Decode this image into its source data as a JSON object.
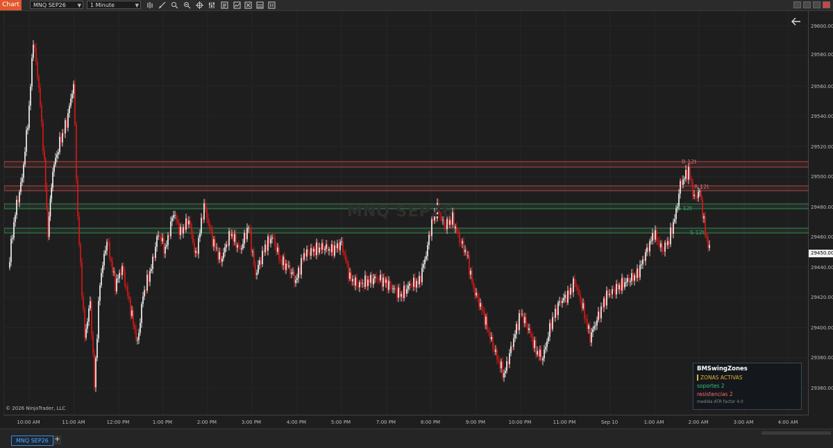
{
  "toolbar": {
    "chart_tab": "Chart",
    "instrument": "MNQ SEP26",
    "interval": "1 Minute",
    "icons": [
      "bars-icon",
      "draw-icon",
      "zoom-icon",
      "crosshair-icon",
      "data-box-icon",
      "indicators-icon",
      "strategies-icon",
      "properties-icon",
      "templates-icon",
      "chart-trader-icon"
    ]
  },
  "chart": {
    "watermark": "MNQ SEP26",
    "copyright": "© 2026 NinjaTrader, LLC",
    "current_price": "29450.00",
    "zone_labels": {
      "r1": "R 12t",
      "r2": "R 12t",
      "s1": "S 12t",
      "s2": "S 12t"
    },
    "colors": {
      "up": "#ffffff",
      "down": "#e01818",
      "resistance": "#d05050",
      "support": "#3fa060"
    }
  },
  "price_axis": [
    "29600.00",
    "29580.00",
    "29560.00",
    "29540.00",
    "29520.00",
    "29500.00",
    "29480.00",
    "29460.00",
    "29440.00",
    "29420.00",
    "29400.00",
    "29380.00",
    "29360.00"
  ],
  "time_axis": [
    "10:00 AM",
    "11:00 AM",
    "12:00 PM",
    "1:00 PM",
    "2:00 PM",
    "3:00 PM",
    "4:00 PM",
    "5:00 PM",
    "7:00 PM",
    "8:00 PM",
    "9:00 PM",
    "10:00 PM",
    "11:00 PM",
    "Sep 10",
    "1:00 AM",
    "2:00 AM",
    "3:00 AM",
    "4:00 AM"
  ],
  "legend": {
    "title": "BMSwingZones",
    "zonas": "ZONAS ACTIVAS",
    "soportes": "soportes  2",
    "resistencias": "resistencias  2",
    "meta": "medida ATR   factor 4.0"
  },
  "tabs": {
    "instrument_tab": "MNQ SEP26",
    "add": "+"
  }
}
